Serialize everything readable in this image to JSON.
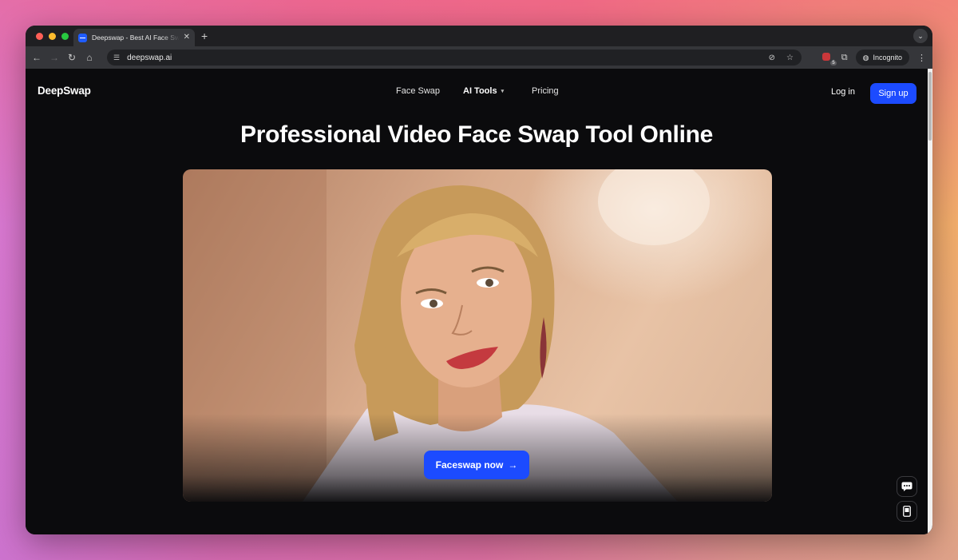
{
  "browser": {
    "tab_title": "Deepswap - Best AI Face Swap",
    "url": "deepswap.ai",
    "incognito_label": "Incognito",
    "extension_badge": "5"
  },
  "nav": {
    "logo": "DeepSwap",
    "items": [
      {
        "label": "Face Swap"
      },
      {
        "label": "AI Tools"
      },
      {
        "label": "Pricing"
      }
    ],
    "login": "Log in",
    "signup": "Sign up"
  },
  "hero": {
    "title": "Professional Video Face Swap Tool Online",
    "cta_label": "Faceswap now",
    "cta_arrow": "→"
  },
  "icons": {
    "chat": "chat-icon",
    "mobile": "mobile-app-icon"
  },
  "colors": {
    "accent": "#1c4bff",
    "page_bg": "#0b0b0d"
  }
}
